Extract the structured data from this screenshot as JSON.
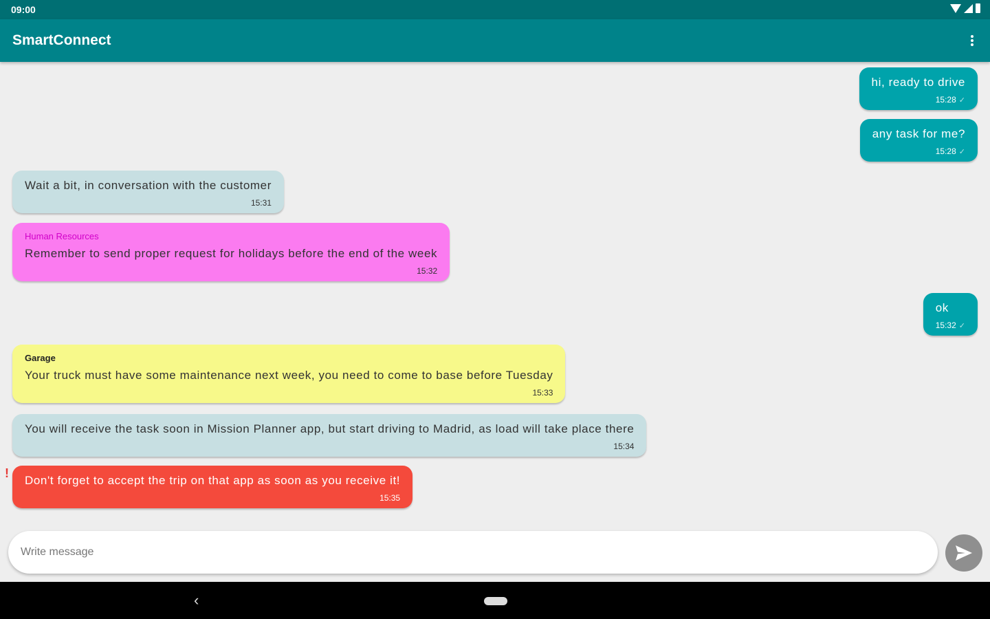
{
  "status_bar": {
    "time": "09:00",
    "icons": [
      "wifi-icon",
      "signal-icon",
      "battery-icon"
    ]
  },
  "app_bar": {
    "title": "SmartConnect",
    "menu_icon": "more-vert-icon"
  },
  "colors": {
    "status_bar": "#006f73",
    "app_bar": "#00838a",
    "outgoing": "#00a3ab",
    "incoming": "#c7dfe2",
    "hr": "#fb7bf0",
    "hr_sender": "#d000c8",
    "garage": "#f7f98a",
    "alert": "#f44a3c"
  },
  "messages": [
    {
      "direction": "out",
      "text": "hi, ready to drive",
      "time": "15:28"
    },
    {
      "direction": "out",
      "text": "any task for me?",
      "time": "15:28"
    },
    {
      "direction": "in",
      "text": "Wait a bit, in conversation with the customer",
      "time": "15:31"
    },
    {
      "direction": "in",
      "sender": "Human Resources",
      "text": "Remember to send proper request for holidays before the end of the week",
      "time": "15:32"
    },
    {
      "direction": "out",
      "text": "ok",
      "time": "15:32"
    },
    {
      "direction": "in",
      "sender": "Garage",
      "text": "Your truck must have some maintenance next week, you need to come to base before Tuesday",
      "time": "15:33"
    },
    {
      "direction": "in",
      "text": "You will receive the task soon in Mission Planner app, but start driving to Madrid, as load will take place there",
      "time": "15:34"
    },
    {
      "direction": "in",
      "priority_mark": "!",
      "text": "Don't forget to accept the trip on that app as soon as you receive it!",
      "time": "15:35"
    }
  ],
  "composer": {
    "placeholder": "Write message",
    "value": "",
    "send_icon": "send-icon"
  },
  "nav_bar": {
    "back_icon": "back-icon",
    "home_icon": "home-pill-icon"
  }
}
